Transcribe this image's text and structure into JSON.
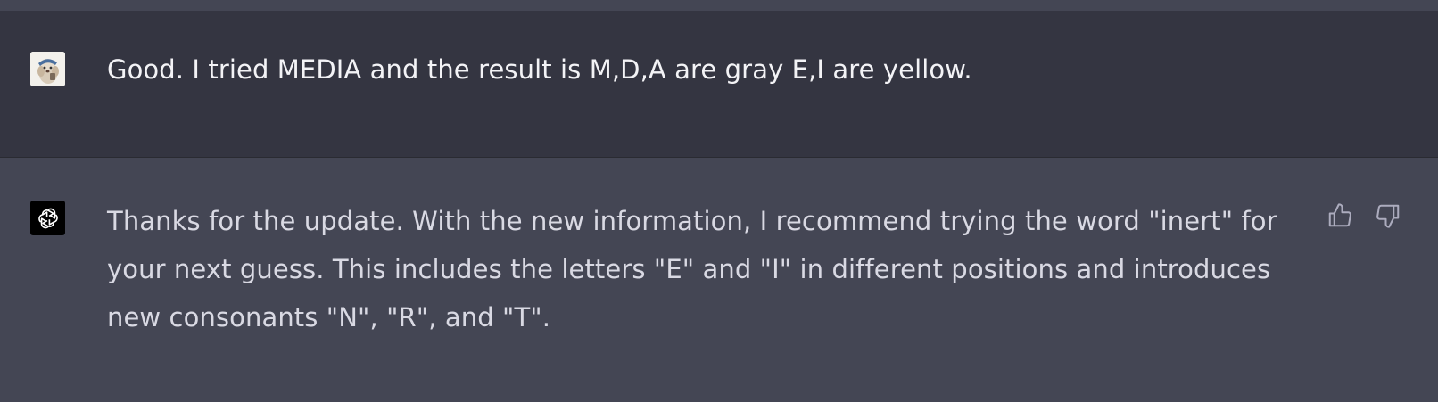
{
  "conversation": {
    "user_message": {
      "avatar_icon": "user-avatar-photo",
      "text": "Good. I tried MEDIA and the result is M,D,A are gray E,I are yellow."
    },
    "assistant_message": {
      "avatar_icon": "openai-logo-icon",
      "text": "Thanks for the update. With the new information, I recommend trying the word \"inert\" for your next guess. This includes the letters \"E\" and \"I\" in different positions and introduces new consonants \"N\", \"R\", and \"T\".",
      "actions": {
        "thumbs_up_icon": "thumbs-up-icon",
        "thumbs_down_icon": "thumbs-down-icon"
      }
    }
  },
  "colors": {
    "user_bg": "#343541",
    "assistant_bg": "#444654",
    "text": "#ececf1",
    "icon": "#acacbe"
  }
}
